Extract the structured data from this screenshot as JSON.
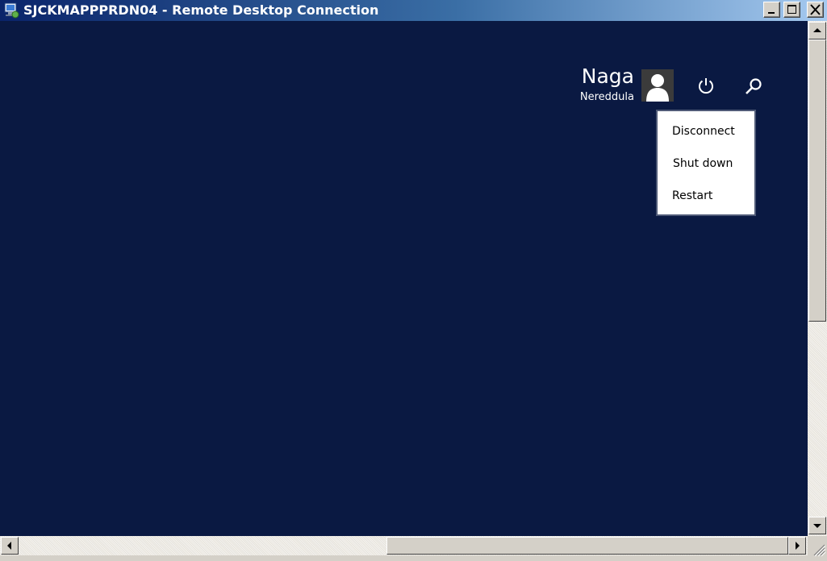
{
  "window": {
    "title": "SJCKMAPPPRDN04 - Remote Desktop Connection",
    "icon": "remote-desktop-icon",
    "controls": [
      "minimize-icon",
      "maximize-icon",
      "close-icon"
    ]
  },
  "colors": {
    "desktop_background": "#0a1942",
    "titlebar_start": "#0a246a",
    "titlebar_end": "#a6caf0",
    "menu_border": "#4f5a77"
  },
  "user": {
    "first_name": "Naga",
    "last_name": "Nereddula",
    "avatar_icon": "user-avatar-icon"
  },
  "toolbar": {
    "power_icon": "power-icon",
    "search_icon": "search-icon"
  },
  "power_menu": {
    "items": [
      {
        "label": "Disconnect"
      },
      {
        "label": "Shut down"
      },
      {
        "label": "Restart"
      }
    ]
  }
}
